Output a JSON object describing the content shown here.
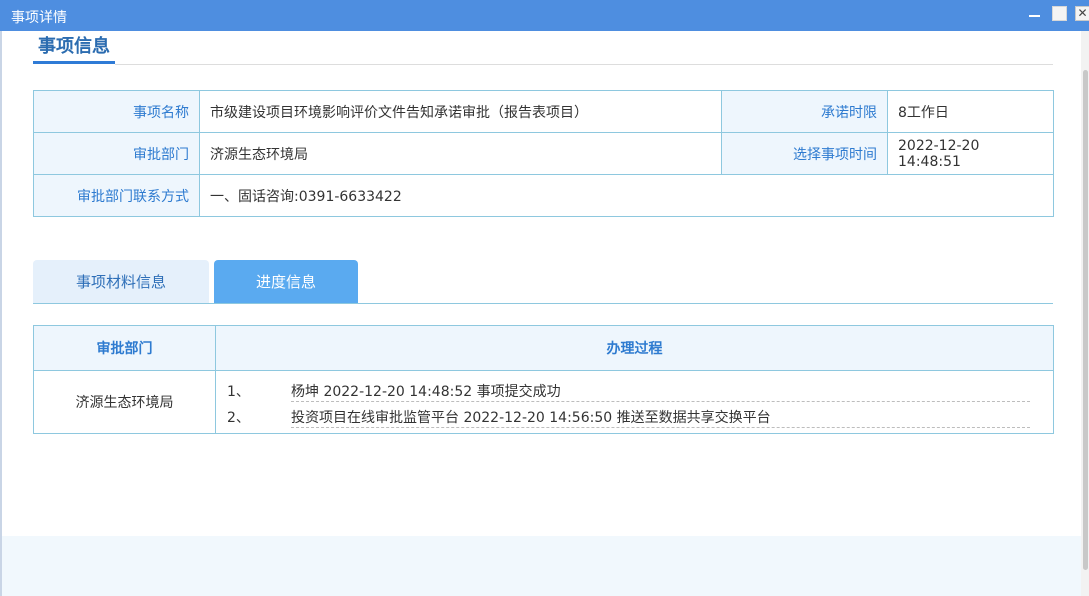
{
  "window": {
    "title": "事项详情",
    "close_glyph": "✕"
  },
  "section": {
    "title": "事项信息"
  },
  "info": {
    "item_name_label": "事项名称",
    "item_name_value": "市级建设项目环境影响评价文件告知承诺审批（报告表项目）",
    "promise_time_label": "承诺时限",
    "promise_time_value": "8工作日",
    "dept_label": "审批部门",
    "dept_value": "济源生态环境局",
    "select_time_label": "选择事项时间",
    "select_time_value": "2022-12-20 14:48:51",
    "contact_label": "审批部门联系方式",
    "contact_value": "一、固话咨询:0391-6633422"
  },
  "tabs": [
    {
      "label": "事项材料信息",
      "active": false
    },
    {
      "label": "进度信息",
      "active": true
    }
  ],
  "progress": {
    "col_dept": "审批部门",
    "col_process": "办理过程",
    "rows": [
      {
        "dept": "济源生态环境局",
        "steps": [
          {
            "num": "1、",
            "text": "杨坤 2022-12-20 14:48:52 事项提交成功"
          },
          {
            "num": "2、",
            "text": "投资项目在线审批监管平台 2022-12-20 14:56:50 推送至数据共享交换平台"
          }
        ]
      }
    ]
  },
  "colors": {
    "title_bar": "#4e8ee0",
    "label_text": "#2e7bd0",
    "label_bg": "#eef6fd",
    "border": "#8ec8df",
    "active_tab": "#5aaaf0",
    "inactive_tab": "#e5f0fb"
  }
}
